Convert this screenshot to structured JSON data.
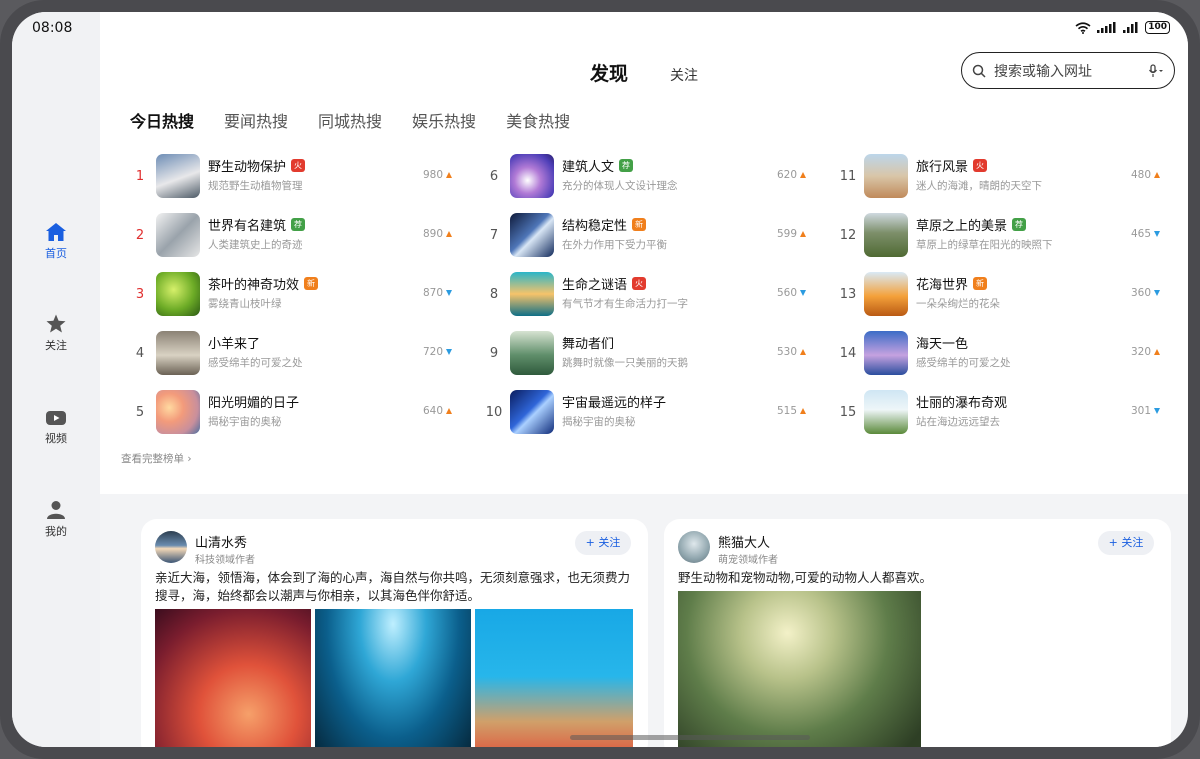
{
  "status": {
    "time": "08:08",
    "battery": "100"
  },
  "sidebar": {
    "items": [
      {
        "label": "首页",
        "icon": "home-icon",
        "active": true
      },
      {
        "label": "关注",
        "icon": "star-icon",
        "active": false
      },
      {
        "label": "视频",
        "icon": "video-icon",
        "active": false
      },
      {
        "label": "我的",
        "icon": "person-icon",
        "active": false
      }
    ]
  },
  "header": {
    "tabs": [
      {
        "label": "发现",
        "active": true
      },
      {
        "label": "关注",
        "active": false
      }
    ],
    "search_placeholder": "搜索或输入网址"
  },
  "categories": [
    "今日热搜",
    "要闻热搜",
    "同城热搜",
    "娱乐热搜",
    "美食热搜"
  ],
  "hot_list": [
    {
      "rank": "1",
      "title": "野生动物保护",
      "badge": "火",
      "subtitle": "规范野生动植物管理",
      "count": "980",
      "trend": "up"
    },
    {
      "rank": "2",
      "title": "世界有名建筑",
      "badge": "荐",
      "subtitle": "人类建筑史上的奇迹",
      "count": "890",
      "trend": "up"
    },
    {
      "rank": "3",
      "title": "茶叶的神奇功效",
      "badge": "新",
      "subtitle": "雾绕青山枝叶绿",
      "count": "870",
      "trend": "down"
    },
    {
      "rank": "4",
      "title": "小羊来了",
      "badge": "",
      "subtitle": "感受绵羊的可爱之处",
      "count": "720",
      "trend": "down"
    },
    {
      "rank": "5",
      "title": "阳光明媚的日子",
      "badge": "",
      "subtitle": "揭秘宇宙的奥秘",
      "count": "640",
      "trend": "up"
    },
    {
      "rank": "6",
      "title": "建筑人文",
      "badge": "荐",
      "subtitle": "充分的体现人文设计理念",
      "count": "620",
      "trend": "up"
    },
    {
      "rank": "7",
      "title": "结构稳定性",
      "badge": "新",
      "subtitle": "在外力作用下受力平衡",
      "count": "599",
      "trend": "up"
    },
    {
      "rank": "8",
      "title": "生命之谜语",
      "badge": "火",
      "subtitle": "有气节才有生命活力打一字",
      "count": "560",
      "trend": "down"
    },
    {
      "rank": "9",
      "title": "舞动者们",
      "badge": "",
      "subtitle": "跳舞时就像一只美丽的天鹅",
      "count": "530",
      "trend": "up"
    },
    {
      "rank": "10",
      "title": "宇宙最遥远的样子",
      "badge": "",
      "subtitle": "揭秘宇宙的奥秘",
      "count": "515",
      "trend": "up"
    },
    {
      "rank": "11",
      "title": "旅行风景",
      "badge": "火",
      "subtitle": "迷人的海滩，晴朗的天空下",
      "count": "480",
      "trend": "up"
    },
    {
      "rank": "12",
      "title": "草原之上的美景",
      "badge": "荐",
      "subtitle": "草原上的绿草在阳光的映照下",
      "count": "465",
      "trend": "down"
    },
    {
      "rank": "13",
      "title": "花海世界",
      "badge": "新",
      "subtitle": "一朵朵绚烂的花朵",
      "count": "360",
      "trend": "down"
    },
    {
      "rank": "14",
      "title": "海天一色",
      "badge": "",
      "subtitle": "感受绵羊的可爱之处",
      "count": "320",
      "trend": "up"
    },
    {
      "rank": "15",
      "title": "壮丽的瀑布奇观",
      "badge": "",
      "subtitle": "站在海边远远望去",
      "count": "301",
      "trend": "down"
    }
  ],
  "view_all": "查看完整榜单",
  "posts": [
    {
      "author": "山清水秀",
      "role": "科技领域作者",
      "follow_label": "+ 关注",
      "text": "亲近大海，领悟海，体会到了海的心声，海自然与你共鸣，无须刻意强求，也无须费力搜寻，海，始终都会以潮声与你相亲，以其海色伴你舒适。"
    },
    {
      "author": "熊猫大人",
      "role": "萌宠领域作者",
      "follow_label": "+ 关注",
      "text": "野生动物和宠物动物,可爱的动物人人都喜欢。"
    }
  ],
  "colors": {
    "accent": "#1a5fe0",
    "hot": "#e23b2e",
    "recommend": "#43a047",
    "new": "#f07f1c",
    "trend_up": "#f07f1c",
    "trend_down": "#2b9be0"
  }
}
